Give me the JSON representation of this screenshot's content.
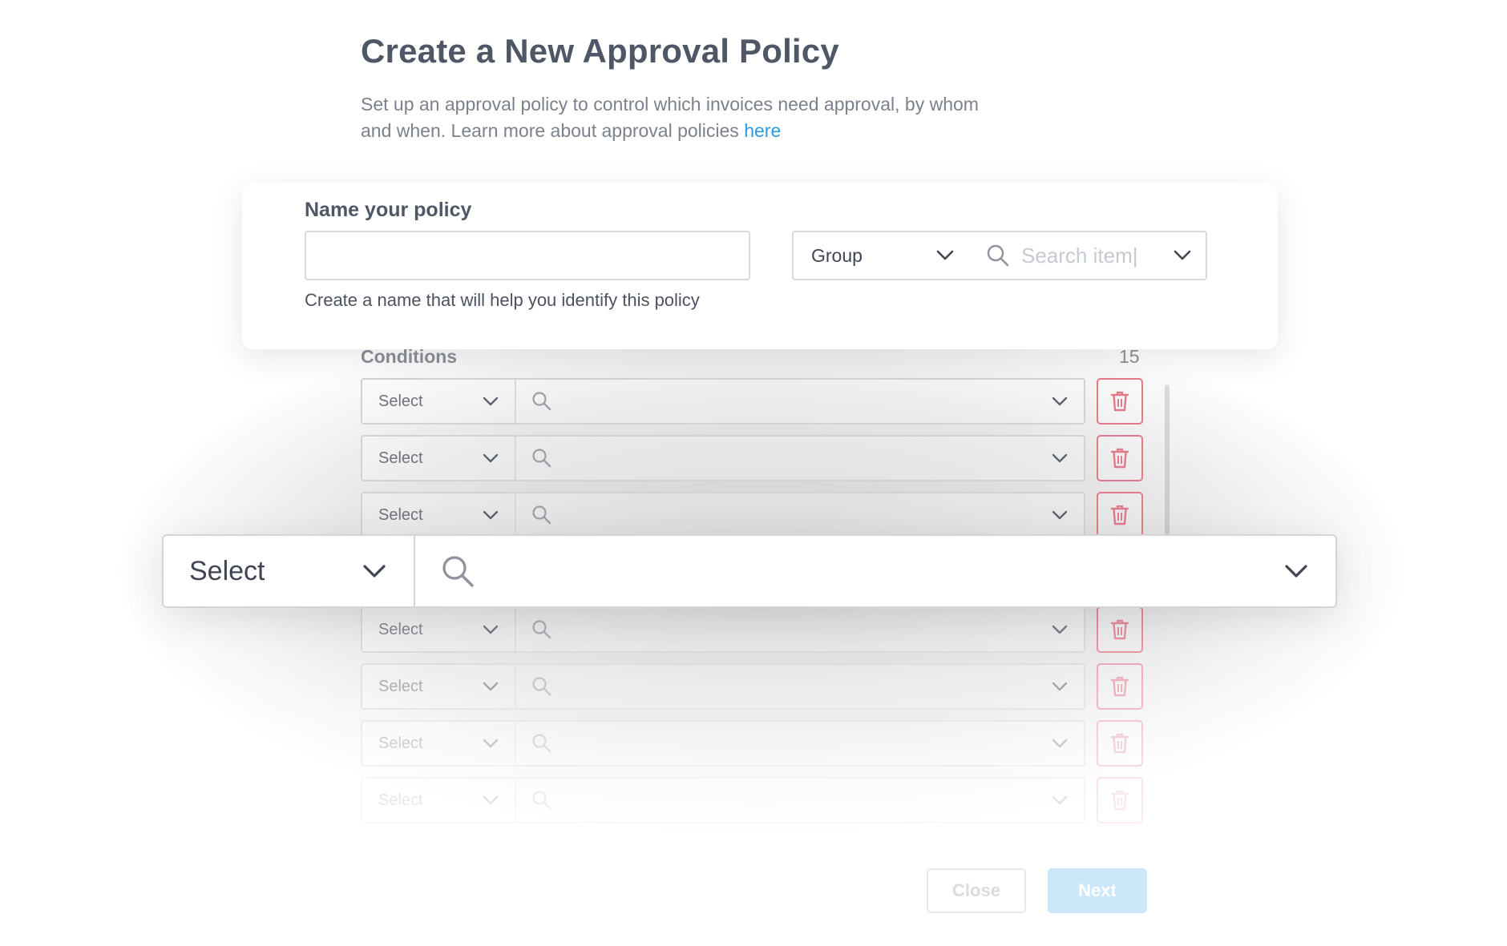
{
  "header": {
    "title": "Create a New Approval Policy",
    "description": "Set up an approval policy to control which invoices need approval, by whom and when. Learn more about approval policies ",
    "link_text": "here"
  },
  "policy_form": {
    "name_label": "Name your policy",
    "name_value": "",
    "name_helper": "Create a name that will help you identify this policy",
    "group_select_value": "Group",
    "search_placeholder": "Search item|"
  },
  "conditions": {
    "label": "Conditions",
    "count": "15",
    "rows": [
      {
        "select_label": "Select"
      },
      {
        "select_label": "Select"
      },
      {
        "select_label": "Select"
      },
      {
        "select_label": "Select"
      },
      {
        "select_label": "Select"
      },
      {
        "select_label": "Select"
      },
      {
        "select_label": "Select"
      }
    ]
  },
  "focused_condition": {
    "select_label": "Select"
  },
  "footer": {
    "close_label": "Close",
    "next_label": "Next"
  },
  "colors": {
    "link": "#2a9be0",
    "trash": "#e07a8a",
    "next_button": "#cde7fa"
  },
  "icons": {
    "search": "search-icon",
    "chevron": "chevron-down-icon",
    "delete": "trash-icon"
  }
}
